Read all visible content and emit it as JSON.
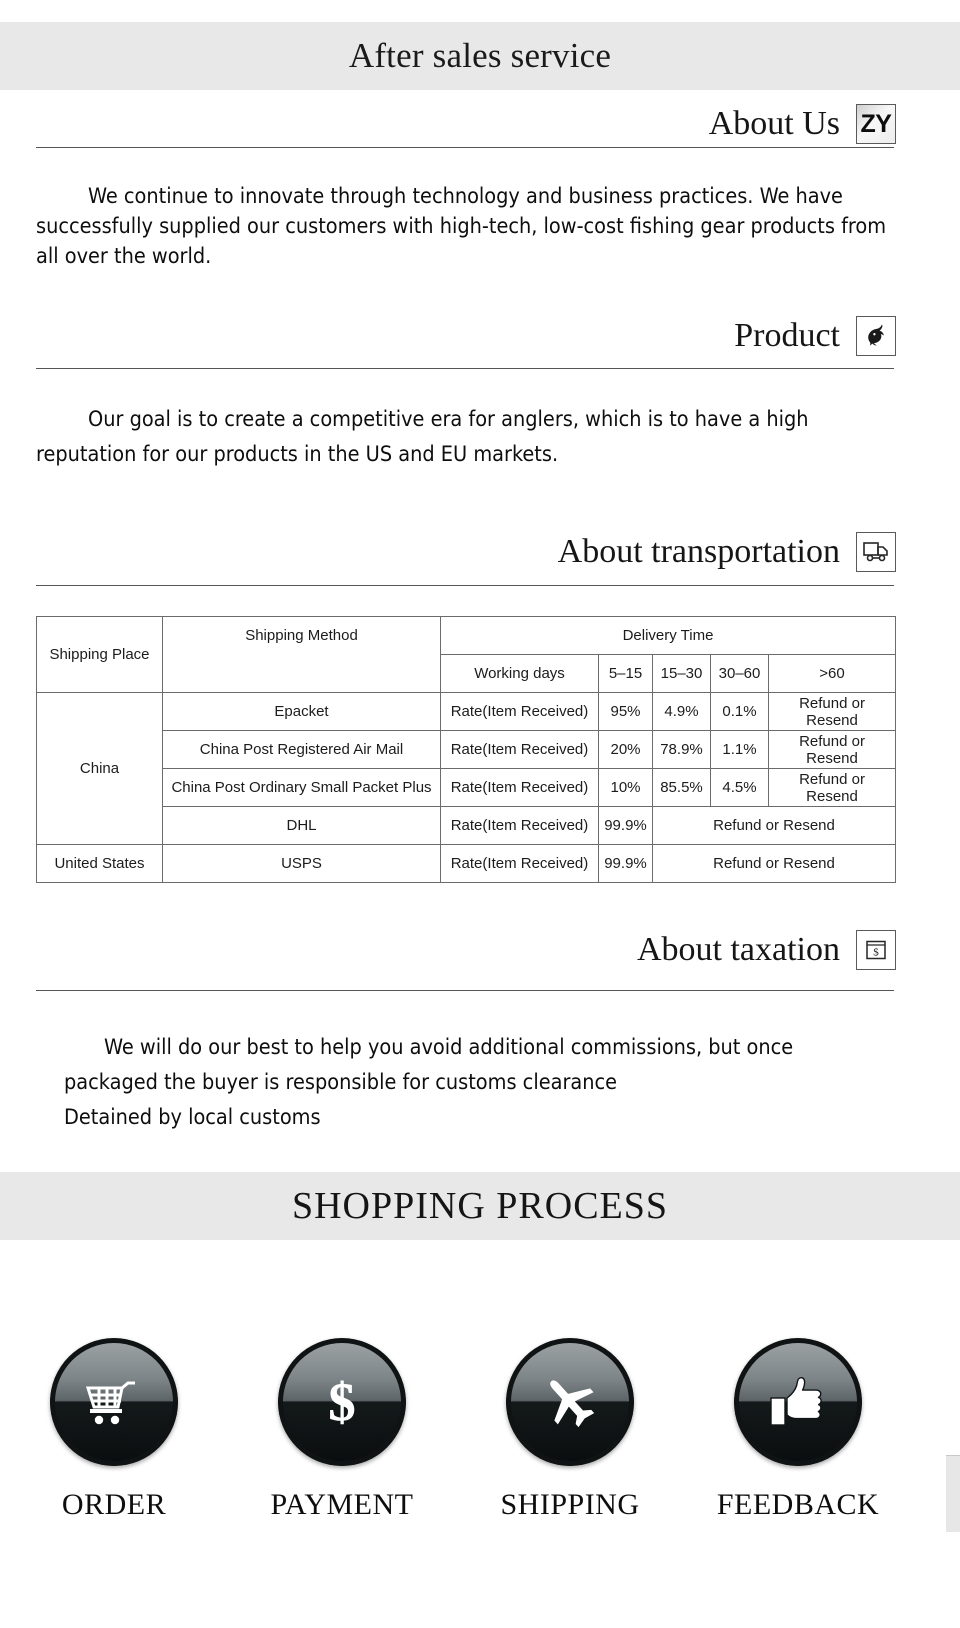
{
  "page": {
    "top_banner": "After sales service",
    "shopping_banner": "SHOPPING PROCESS"
  },
  "sections": [
    {
      "heading": "About Us",
      "icon": "zy-logo-icon",
      "icon_text": "ZY",
      "body": "We continue to innovate through technology and business practices. We have successfully supplied our customers with high-tech, low-cost fishing gear products from all over the world."
    },
    {
      "heading": "Product",
      "icon": "fish-icon",
      "body": "Our goal is to create a competitive era for anglers, which is to have a high reputation for our products in the US and EU markets."
    },
    {
      "heading": "About transportation",
      "icon": "delivery-truck-icon"
    },
    {
      "heading": "About taxation",
      "icon": "money-bill-icon",
      "body_line_1": "We will do our best to help you avoid additional commissions, but once",
      "body_line_2": "packaged the buyer is responsible for customs clearance",
      "body_line_3": "Detained by local customs"
    }
  ],
  "shipping_table": {
    "headers": {
      "shipping_place": "Shipping Place",
      "shipping_method": "Shipping Method",
      "delivery_time": "Delivery Time"
    },
    "subheaders": {
      "working_days": "Working days",
      "range_1": "5–15",
      "range_2": "15–30",
      "range_3": "30–60",
      "range_4": ">60"
    },
    "rows": [
      {
        "place": "China",
        "method": "Epacket",
        "rate_label": "Rate(Item Received)",
        "r1": "95%",
        "r2": "4.9%",
        "r3": "0.1%",
        "r4": "Refund or Resend"
      },
      {
        "method": "China Post Registered Air Mail",
        "rate_label": "Rate(Item Received)",
        "r1": "20%",
        "r2": "78.9%",
        "r3": "1.1%",
        "r4": "Refund or Resend"
      },
      {
        "method": "China Post Ordinary Small Packet Plus",
        "rate_label": "Rate(Item Received)",
        "r1": "10%",
        "r2": "85.5%",
        "r3": "4.5%",
        "r4": "Refund or Resend"
      },
      {
        "method": "DHL",
        "rate_label": "Rate(Item Received)",
        "r1": "99.9%",
        "r_merged": "Refund or Resend"
      },
      {
        "place": "United States",
        "method": "USPS",
        "rate_label": "Rate(Item Received)",
        "r1": "99.9%",
        "r_merged": "Refund or Resend"
      }
    ]
  },
  "process": [
    {
      "label": "ORDER",
      "icon": "shopping-cart-icon"
    },
    {
      "label": "PAYMENT",
      "icon": "dollar-sign-icon"
    },
    {
      "label": "SHIPPING",
      "icon": "airplane-icon"
    },
    {
      "label": "FEEDBACK",
      "icon": "thumbs-up-icon"
    }
  ],
  "colors": {
    "band_background": "#e8e8e8",
    "rule": "#555555",
    "table_border": "#6b6b6b",
    "circle_dark": "#0a0d0e",
    "scrollbar_thumb": "#e7e7e7"
  }
}
